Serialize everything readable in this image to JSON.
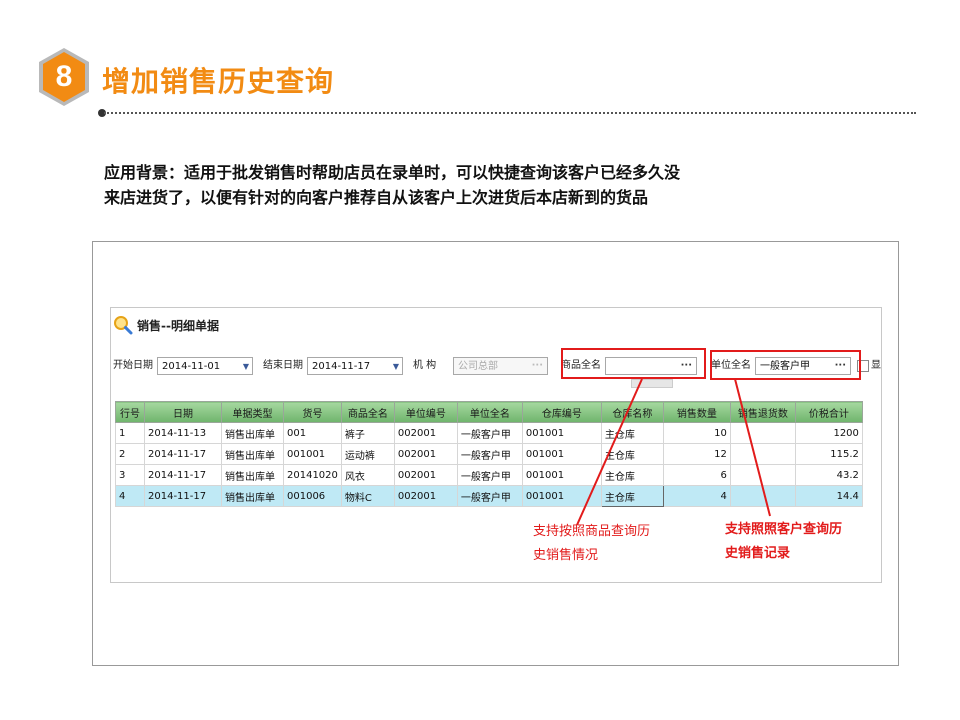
{
  "header": {
    "badge_number": "8",
    "title": "增加销售历史查询"
  },
  "description": {
    "line1": "应用背景：适用于批发销售时帮助店员在录单时，可以快捷查询该客户已经多久没",
    "line2": "来店进货了，以便有针对的向客户推荐自从该客户上次进货后本店新到的货品"
  },
  "window": {
    "title": "销售--明细单据",
    "icon": "search-magnifier-icon"
  },
  "filters": {
    "start_label": "开始日期",
    "start_value": "2014-11-01",
    "end_label": "结束日期",
    "end_value": "2014-11-17",
    "org_label": "机  构",
    "org_value": "公司总部",
    "product_label": "商品全名",
    "product_value": "",
    "unit_label": "单位全名",
    "unit_value": "一般客户甲",
    "extra_label": "显"
  },
  "table": {
    "columns": [
      "行号",
      "日期",
      "单据类型",
      "货号",
      "商品全名",
      "单位编号",
      "单位全名",
      "仓库编号",
      "仓库名称",
      "销售数量",
      "销售退货数",
      "价税合计"
    ],
    "rows": [
      [
        "1",
        "2014-11-13",
        "销售出库单",
        "001",
        "裤子",
        "002001",
        "一般客户甲",
        "001001",
        "主仓库",
        "10",
        "",
        "1200"
      ],
      [
        "2",
        "2014-11-17",
        "销售出库单",
        "001001",
        "运动裤",
        "002001",
        "一般客户甲",
        "001001",
        "主仓库",
        "12",
        "",
        "115.2"
      ],
      [
        "3",
        "2014-11-17",
        "销售出库单",
        "20141020",
        "风衣",
        "002001",
        "一般客户甲",
        "001001",
        "主仓库",
        "6",
        "",
        "43.2"
      ],
      [
        "4",
        "2014-11-17",
        "销售出库单",
        "001006",
        "物料C",
        "002001",
        "一般客户甲",
        "001001",
        "主仓库",
        "4",
        "",
        "14.4"
      ]
    ]
  },
  "callouts": {
    "product_line1": "支持按照商品查询历",
    "product_line2": "史销售情况",
    "customer_line1": "支持照照客户查询历",
    "customer_line2": "史销售记录"
  },
  "colors": {
    "accent": "#f28b13",
    "highlight": "#e21b1b",
    "grid_header": "#7fbf7f",
    "selected_row": "#bfe9f5"
  }
}
